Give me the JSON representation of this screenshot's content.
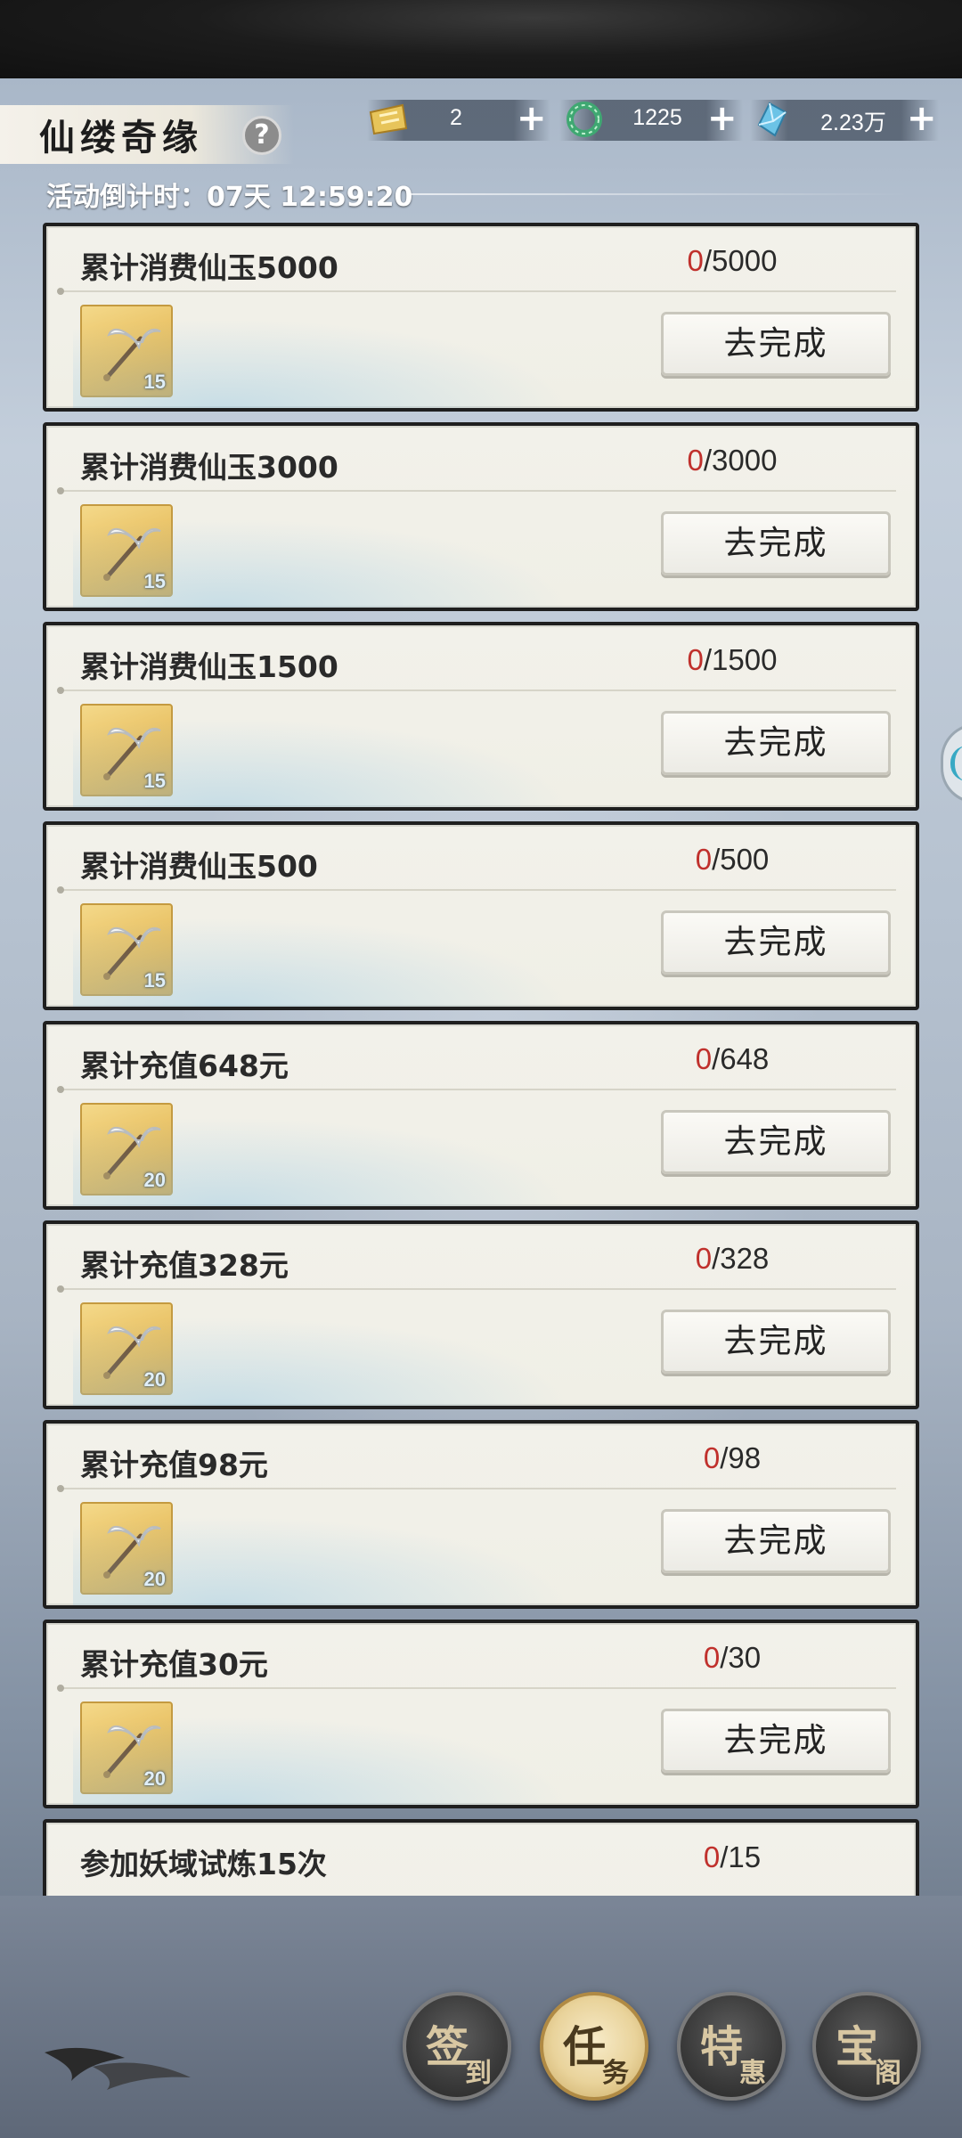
{
  "header": {
    "title": "仙缕奇缘",
    "help_label": "?",
    "countdown": "活动倒计时：07天 12:59:20"
  },
  "currencies": [
    {
      "icon": "gold-ticket-icon",
      "value": "2",
      "plus": "+"
    },
    {
      "icon": "jade-ring-icon",
      "value": "1225",
      "plus": "+"
    },
    {
      "icon": "spirit-crystal-icon",
      "value": "2.23万",
      "plus": "+"
    }
  ],
  "tasks": [
    {
      "title": "累计消费仙玉5000",
      "current": "0",
      "target": "/5000",
      "reward_count": "15",
      "button": "去完成"
    },
    {
      "title": "累计消费仙玉3000",
      "current": "0",
      "target": "/3000",
      "reward_count": "15",
      "button": "去完成"
    },
    {
      "title": "累计消费仙玉1500",
      "current": "0",
      "target": "/1500",
      "reward_count": "15",
      "button": "去完成"
    },
    {
      "title": "累计消费仙玉500",
      "current": "0",
      "target": "/500",
      "reward_count": "15",
      "button": "去完成"
    },
    {
      "title": "累计充值648元",
      "current": "0",
      "target": "/648",
      "reward_count": "20",
      "button": "去完成"
    },
    {
      "title": "累计充值328元",
      "current": "0",
      "target": "/328",
      "reward_count": "20",
      "button": "去完成"
    },
    {
      "title": "累计充值98元",
      "current": "0",
      "target": "/98",
      "reward_count": "20",
      "button": "去完成"
    },
    {
      "title": "累计充值30元",
      "current": "0",
      "target": "/30",
      "reward_count": "20",
      "button": "去完成"
    },
    {
      "title": "参加妖域试炼15次",
      "current": "0",
      "target": "/15",
      "reward_count": "",
      "button": ""
    }
  ],
  "nav": [
    {
      "big": "签",
      "small": "到",
      "active": false
    },
    {
      "big": "任",
      "small": "务",
      "active": true
    },
    {
      "big": "特",
      "small": "惠",
      "active": false
    },
    {
      "big": "宝",
      "small": "阁",
      "active": false
    }
  ],
  "colors": {
    "progress_current": "#c0302c",
    "card_bg": "#f0efe6",
    "reward_gold": "#e6bb5a"
  }
}
